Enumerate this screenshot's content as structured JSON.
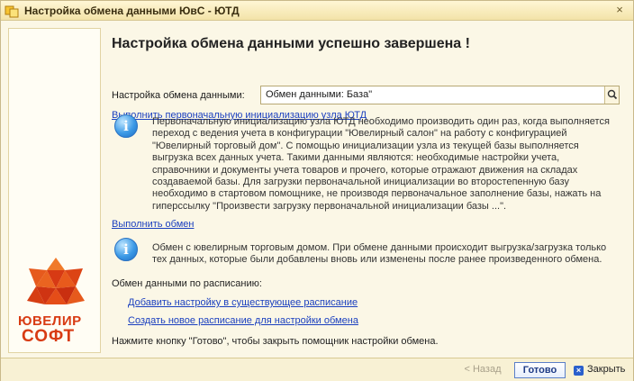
{
  "window": {
    "title": "Настройка обмена данными ЮвС - ЮТД",
    "close_glyph": "×"
  },
  "logo": {
    "word1": "ЮВЕЛИР",
    "word2": "СОФТ",
    "color": "#d83b13"
  },
  "main": {
    "heading": "Настройка обмена данными успешно завершена !",
    "field_label": "Настройка обмена данными:",
    "field_value": "Обмен данными: База\"",
    "link_init": "Выполнить первоначальную инициализацию узла ЮТД",
    "info1_lines": [
      "Первоначальную инициализацию узла ЮТД необходимо производить один раз, когда выполняется",
      "переход с ведения учета в конфигурации \"Ювелирный салон\" на работу с конфигурацией",
      "\"Ювелирный торговый дом\". С помощью инициализации узла из текущей базы выполняется",
      "выгрузка всех данных учета. Такими данными являются: необходимые настройки учета,",
      "справочники и документы учета товаров и прочего, которые отражают движения на складах",
      "создаваемой базы. Для загрузки первоначальной инициализации во второстепенную базу",
      "необходимо в стартовом помощнике, не производя первоначальное заполнение базы, нажать на",
      "гиперссылку \"Произвести загрузку первоначальной инициализации базы ...\"."
    ],
    "link_exchange": "Выполнить обмен",
    "info2_lines": [
      "Обмен с ювелирным торговым домом. При обмене данными происходит выгрузка/загрузка только",
      "тех данных, которые были добавлены вновь или изменены после ранее произведенного обмена."
    ],
    "schedule_label": "Обмен данными по расписанию:",
    "link_add_schedule": "Добавить настройку в существующее расписание",
    "link_new_schedule": "Создать новое расписание для настройки обмена",
    "hint": "Нажмите кнопку \"Готово\", чтобы закрыть помощник настройки обмена."
  },
  "footer": {
    "back_label": "< Назад",
    "done_label": "Готово",
    "close_label": "Закрыть"
  }
}
